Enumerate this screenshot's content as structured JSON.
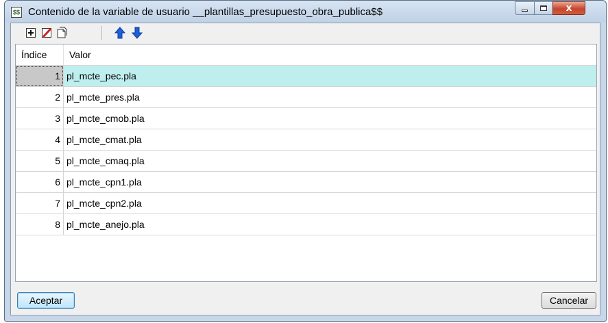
{
  "window": {
    "title": "Contenido de la variable de usuario __plantillas_presupuesto_obra_publica$$",
    "app_icon_glyph": "$$",
    "close_glyph": "x"
  },
  "toolbar": {
    "buttons": [
      {
        "name": "add-row-icon"
      },
      {
        "name": "delete-row-icon"
      },
      {
        "name": "copy-row-icon"
      },
      {
        "name": "move-up-icon"
      },
      {
        "name": "move-down-icon"
      }
    ]
  },
  "grid": {
    "headers": {
      "index": "Índice",
      "value": "Valor"
    },
    "rows": [
      {
        "index": "1",
        "value": "pl_mcte_pec.pla"
      },
      {
        "index": "2",
        "value": "pl_mcte_pres.pla"
      },
      {
        "index": "3",
        "value": "pl_mcte_cmob.pla"
      },
      {
        "index": "4",
        "value": "pl_mcte_cmat.pla"
      },
      {
        "index": "5",
        "value": "pl_mcte_cmaq.pla"
      },
      {
        "index": "6",
        "value": "pl_mcte_cpn1.pla"
      },
      {
        "index": "7",
        "value": "pl_mcte_cpn2.pla"
      },
      {
        "index": "8",
        "value": "pl_mcte_anejo.pla"
      }
    ],
    "selected_row": 1
  },
  "footer": {
    "accept_label": "Aceptar",
    "cancel_label": "Cancelar"
  },
  "colors": {
    "selected_row": "#bfeeee",
    "arrow_blue": "#1e5fd8",
    "delete_red": "#d42020"
  }
}
